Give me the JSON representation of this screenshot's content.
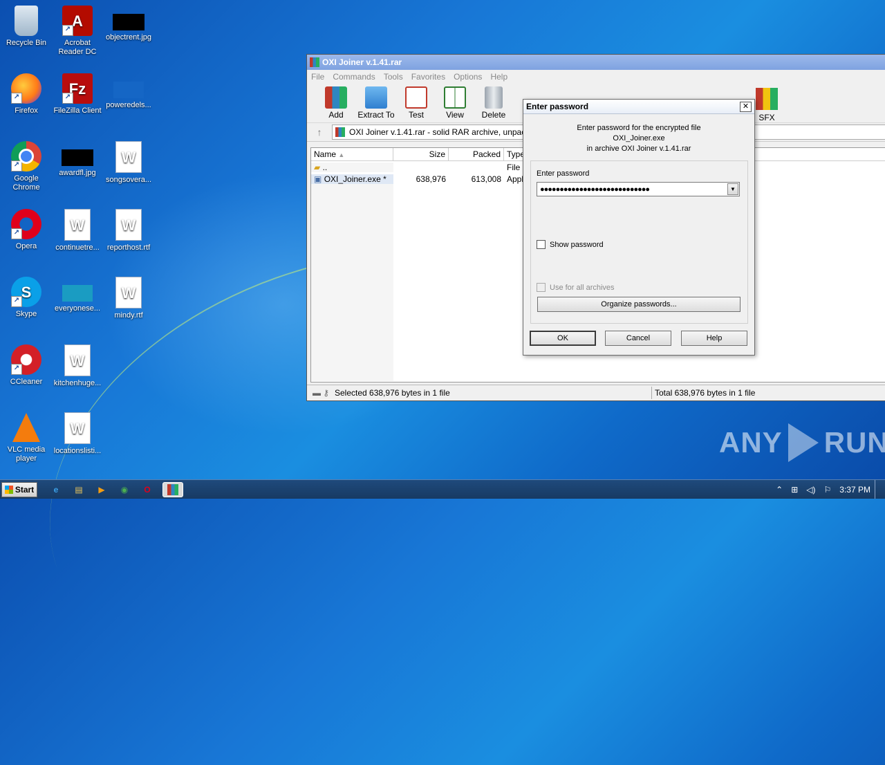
{
  "desktop": {
    "icons": [
      {
        "label": "Recycle Bin"
      },
      {
        "label": "Acrobat Reader DC"
      },
      {
        "label": "objectrent.jpg"
      },
      {
        "label": "Firefox"
      },
      {
        "label": "FileZilla Client"
      },
      {
        "label": "poweredels..."
      },
      {
        "label": "Google Chrome"
      },
      {
        "label": "awardfl.jpg"
      },
      {
        "label": "songsovera..."
      },
      {
        "label": "Opera"
      },
      {
        "label": "continuetre..."
      },
      {
        "label": "reporthost.rtf"
      },
      {
        "label": "Skype"
      },
      {
        "label": "everyonese..."
      },
      {
        "label": "mindy.rtf"
      },
      {
        "label": "CCleaner"
      },
      {
        "label": "kitchenhuge..."
      },
      {
        "label": "VLC media player"
      },
      {
        "label": "locationslisti..."
      }
    ]
  },
  "winrar": {
    "title": "OXI Joiner v.1.41.rar",
    "menu": [
      "File",
      "Commands",
      "Tools",
      "Favorites",
      "Options",
      "Help"
    ],
    "toolbar": [
      "Add",
      "Extract To",
      "Test",
      "View",
      "Delete",
      "SFX"
    ],
    "path": "OXI Joiner v.1.41.rar - solid RAR archive, unpac",
    "columns": [
      "Name",
      "Size",
      "Packed",
      "Type"
    ],
    "rows": [
      {
        "name": "..",
        "size": "",
        "packed": "",
        "type": "File"
      },
      {
        "name": "OXI_Joiner.exe *",
        "size": "638,976",
        "packed": "613,008",
        "type": "Appl"
      }
    ],
    "status_left": "Selected 638,976 bytes in 1 file",
    "status_right": "Total 638,976 bytes in 1 file"
  },
  "dialog": {
    "title": "Enter password",
    "msg1": "Enter password for the encrypted file",
    "msg2": "OXI_Joiner.exe",
    "msg3": "in archive OXI Joiner v.1.41.rar",
    "field_label": "Enter password",
    "password_mask": "●●●●●●●●●●●●●●●●●●●●●●●●●●●●",
    "show_password": "Show password",
    "use_for_all": "Use for all archives",
    "organize": "Organize passwords...",
    "ok": "OK",
    "cancel": "Cancel",
    "help": "Help"
  },
  "taskbar": {
    "start": "Start",
    "clock": "3:37 PM"
  },
  "watermark": {
    "left": "ANY",
    "right": "RUN"
  },
  "colors": {
    "accent": "#7ea2e0",
    "desktop": "#1877d6"
  }
}
